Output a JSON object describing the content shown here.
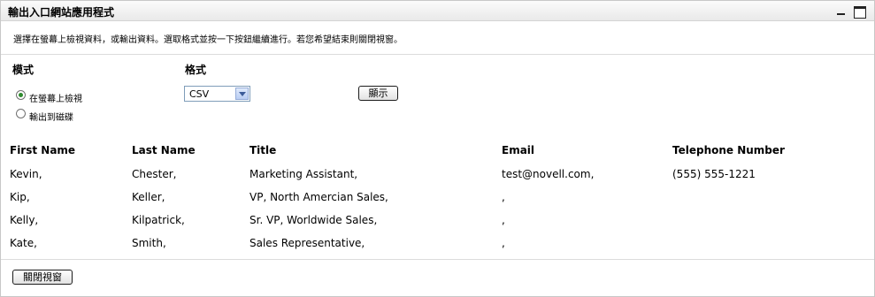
{
  "window": {
    "title": "輸出入口網站應用程式"
  },
  "intro": "選擇在螢幕上檢視資料，或輸出資料。選取格式並按一下按鈕繼續進行。若您希望結束則關閉視窗。",
  "mode": {
    "label": "模式",
    "options": [
      {
        "label": "在螢幕上檢視",
        "selected": true
      },
      {
        "label": "輸出到磁碟",
        "selected": false
      }
    ]
  },
  "format": {
    "label": "格式",
    "selected": "CSV"
  },
  "display_button": "顯示",
  "table": {
    "headers": [
      "First Name",
      "Last Name",
      "Title",
      "Email",
      "Telephone Number"
    ],
    "rows": [
      [
        "Kevin,",
        "Chester,",
        "Marketing Assistant,",
        "test@novell.com,",
        "(555) 555-1221"
      ],
      [
        "Kip,",
        "Keller,",
        "VP, North Amercian Sales,",
        ",",
        ""
      ],
      [
        "Kelly,",
        "Kilpatrick,",
        "Sr. VP, Worldwide Sales,",
        ",",
        ""
      ],
      [
        "Kate,",
        "Smith,",
        "Sales Representative,",
        ",",
        ""
      ]
    ]
  },
  "close_button": "關閉視窗"
}
